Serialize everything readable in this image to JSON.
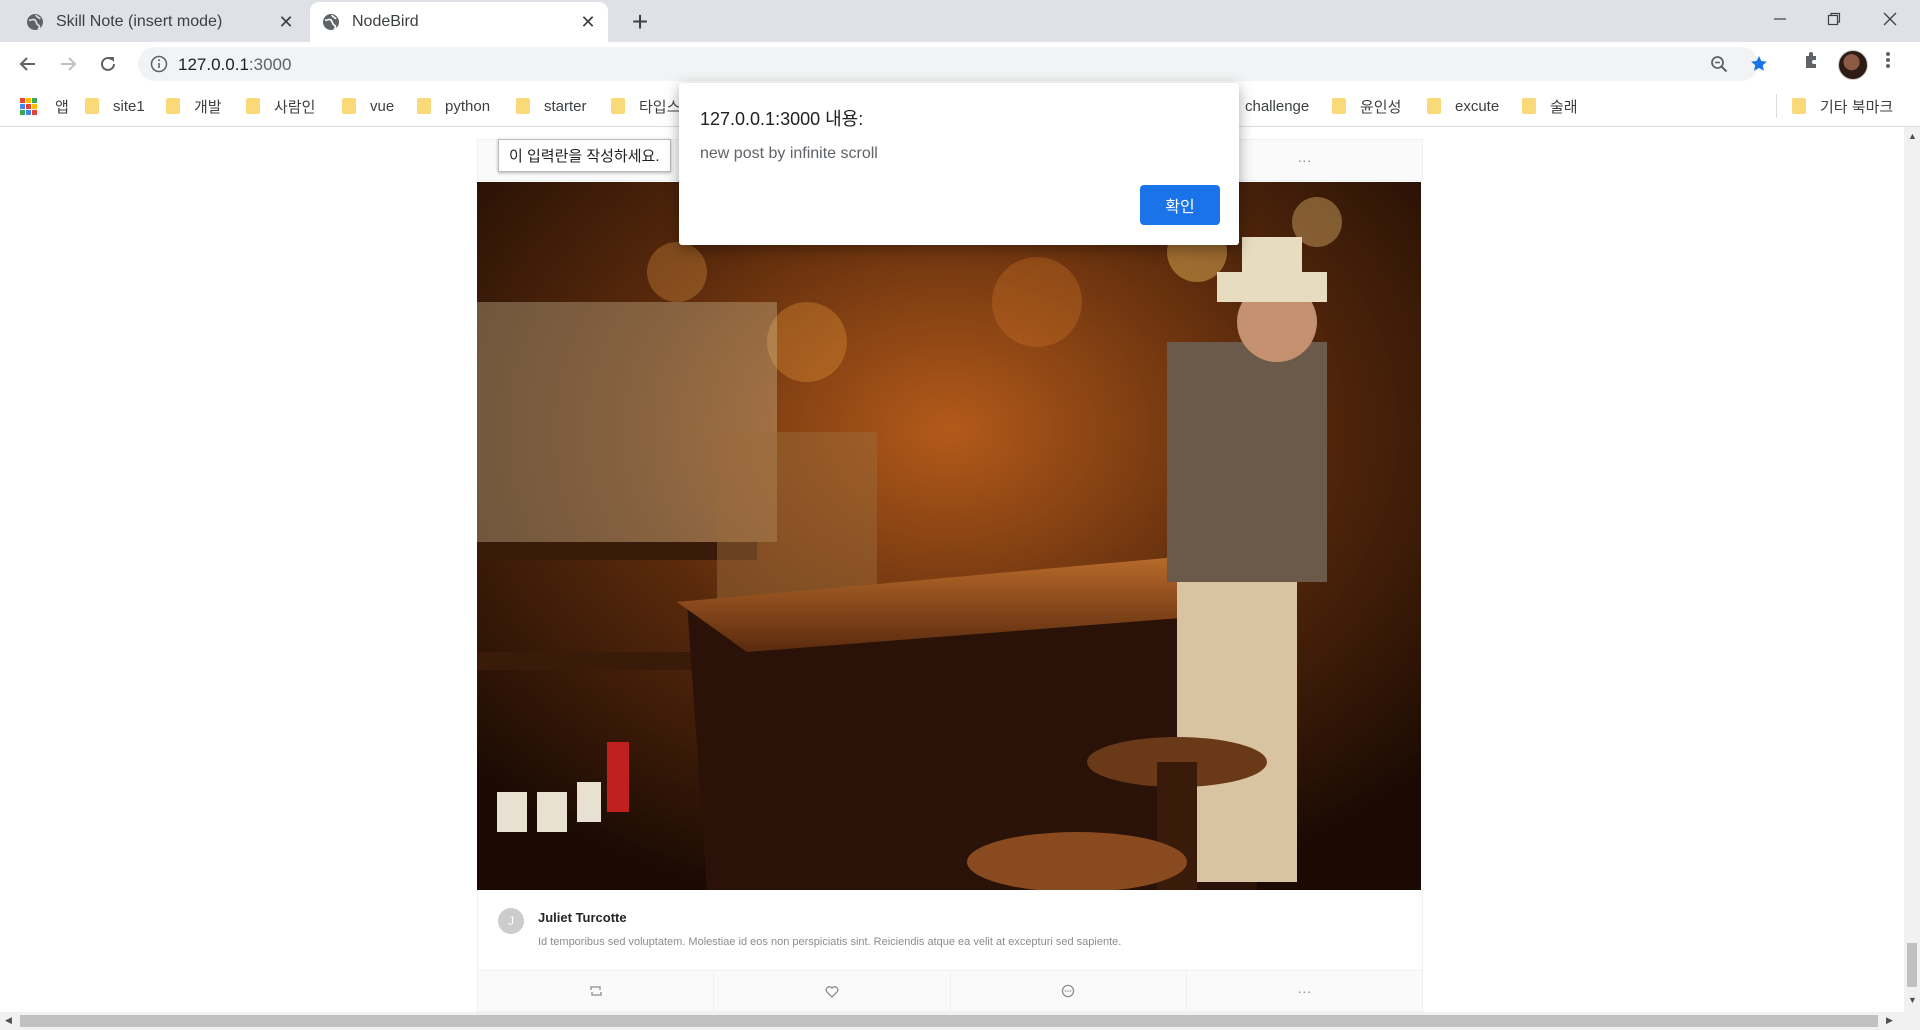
{
  "tabs": [
    {
      "title": "Skill Note (insert mode)",
      "close": "✕"
    },
    {
      "title": "NodeBird",
      "close": "✕"
    }
  ],
  "new_tab": "+",
  "address_bar": {
    "host": "127.0.0.1",
    "port": ":3000"
  },
  "bookmarks": {
    "apps_label": "앱",
    "items": [
      "site1",
      "개발",
      "사람인",
      "vue",
      "python",
      "starter",
      "타입스",
      "challenge",
      "윤인성",
      "excute",
      "술래"
    ],
    "other": "기타 북마크"
  },
  "post": {
    "author_initial": "J",
    "author": "Juliet Turcotte",
    "content": "Id temporibus sed voluptatem. Molestiae id eos non perspiciatis sint. Reiciendis atque ea velit at excepturi sed sapiente.",
    "more": "···"
  },
  "validation_tooltip": "이 입력란을 작성하세요.",
  "alert": {
    "title": "127.0.0.1:3000 내용:",
    "message": "new post by infinite scroll",
    "ok": "확인"
  },
  "colors": {
    "accent": "#1a73e8",
    "bookmark_folder": "#f9d978",
    "star": "#1a73e8"
  }
}
